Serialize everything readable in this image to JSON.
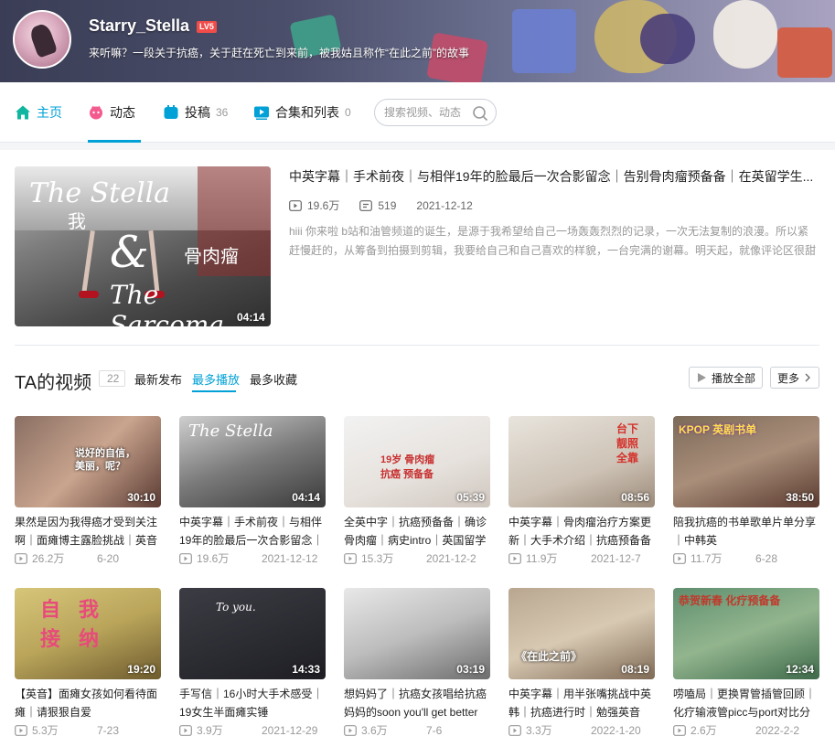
{
  "colors": {
    "accent": "#00a1d6",
    "level_badge": "#f04c49",
    "meta_text": "#999999"
  },
  "profile": {
    "username": "Starry_Stella",
    "level": "LV5",
    "signature": "来听嘛？一段关于抗癌，关于赶在死亡到来前，被我姑且称作“在此之前”的故事"
  },
  "nav": {
    "home": "主页",
    "dynamic": "动态",
    "uploads": "投稿",
    "uploads_count": "36",
    "collections": "合集和列表",
    "collections_count": "0",
    "search_placeholder": "搜索视频、动态"
  },
  "featured": {
    "title": "中英字幕｜手术前夜｜与相伴19年的脸最后一次合影留念｜告别骨肉瘤预备备｜在英留学生...",
    "plays": "19.6万",
    "comments": "519",
    "date": "2021-12-12",
    "duration": "04:14",
    "description": "hiii 你来啦 b站和油管频道的诞生，是源于我希望给自己一场轰轰烈烈的记录，一次无法复制的浪漫。所以紧赶慢赶的，从筹备到拍摄到剪辑，我要给自己和自己喜欢的样貌，一台完满的谢幕。明天起，就像评论区很甜",
    "thumb_text": {
      "top": "The Stella",
      "cn1": "我",
      "amp": "&",
      "cn2": "骨肉瘤",
      "bottom": "The Sarcoma"
    }
  },
  "videos_section": {
    "title": "TA的视频",
    "count": "22",
    "tabs": [
      "最新发布",
      "最多播放",
      "最多收藏"
    ],
    "active_tab": "最多播放",
    "play_all": "播放全部",
    "more": "更多"
  },
  "videos": [
    {
      "title": "果然是因为我得癌才受到关注啊｜面瘫博主露脸挑战｜英音",
      "plays": "26.2万",
      "date": "6-20",
      "duration": "30:10",
      "thumb_text": "说好的自信，美丽，呢？"
    },
    {
      "title": "中英字幕｜手术前夜｜与相伴19年的脸最后一次合影留念｜",
      "plays": "19.6万",
      "date": "2021-12-12",
      "duration": "04:14",
      "thumb_text": "The Stella"
    },
    {
      "title": "全英中字｜抗癌预备备｜确诊骨肉瘤｜病史intro｜英国留学",
      "plays": "15.3万",
      "date": "2021-12-2",
      "duration": "05:39",
      "thumb_text": "19岁 骨肉瘤 抗癌 预备备"
    },
    {
      "title": "中英字幕｜骨肉瘤治疗方案更新｜大手术介绍｜抗癌预备备",
      "plays": "11.9万",
      "date": "2021-12-7",
      "duration": "08:56",
      "thumb_text": "台下靓照全靠"
    },
    {
      "title": "陪我抗癌的书单歌单片单分享｜中韩英",
      "plays": "11.7万",
      "date": "6-28",
      "duration": "38:50",
      "thumb_text": "KPOP 英剧书单"
    },
    {
      "title": "【英音】面瘫女孩如何看待面瘫｜请狠狠自爱",
      "plays": "5.3万",
      "date": "7-23",
      "duration": "19:20",
      "thumb_text": "自我 接纳"
    },
    {
      "title": "手写信｜16小时大手术感受｜19女生半面瘫实锤",
      "plays": "3.9万",
      "date": "2021-12-29",
      "duration": "14:33",
      "thumb_text": "To you."
    },
    {
      "title": "想妈妈了｜抗癌女孩唱给抗癌妈妈的soon you'll get better",
      "plays": "3.6万",
      "date": "7-6",
      "duration": "03:19",
      "thumb_text": ""
    },
    {
      "title": "中英字幕｜用半张嘴挑战中英韩｜抗癌进行时｜勉强英音",
      "plays": "3.3万",
      "date": "2022-1-20",
      "duration": "08:19",
      "thumb_text": "《在此之前》"
    },
    {
      "title": "唠嗑局｜更换胃管插管回顾｜化疗输液管picc与port对比分",
      "plays": "2.6万",
      "date": "2022-2-2",
      "duration": "12:34",
      "thumb_text": "恭贺新春 化疗预备备"
    }
  ]
}
